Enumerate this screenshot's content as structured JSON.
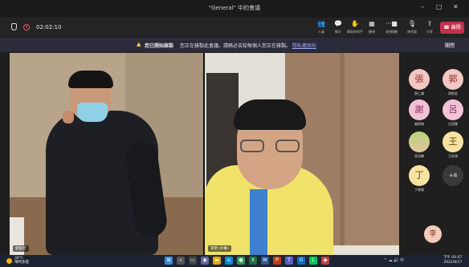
{
  "window": {
    "title": "\"General\" 中的會議",
    "min": "–",
    "max": "□",
    "close": "✕"
  },
  "toolbar": {
    "timer": "02:02:10",
    "buttons": [
      {
        "icon": "people-icon",
        "glyph": "👥",
        "label": "人員"
      },
      {
        "icon": "chat-icon",
        "glyph": "💬",
        "label": "聊天"
      },
      {
        "icon": "raise-hand-icon",
        "glyph": "✋",
        "label": "舉起你的手"
      },
      {
        "icon": "rooms-icon",
        "glyph": "▦",
        "label": "檢視"
      },
      {
        "icon": "more-icon",
        "glyph": "···",
        "label": "其他"
      },
      {
        "icon": "camera-icon",
        "glyph": "■",
        "label": "相機"
      },
      {
        "icon": "mic-off-icon",
        "glyph": "🎙",
        "label": "麥克風"
      },
      {
        "icon": "share-icon",
        "glyph": "⇪",
        "label": "分享"
      }
    ],
    "leave": "離開"
  },
  "banner": {
    "title": "您已開始錄製",
    "text": "您正在錄製此會議。請務必告知每個人您正在錄製。",
    "link": "隱私權原則",
    "dismiss": "關閉"
  },
  "stage": {
    "tile_a_name": "劉俊宏",
    "tile_b_name": "李明 (外賓)"
  },
  "participants": [
    {
      "initial": "張",
      "name": "張仁謙",
      "bg": "#f4c7c3",
      "fg": "#8c2a2a"
    },
    {
      "initial": "郭",
      "name": "郭柏宏",
      "bg": "#f4c7c3",
      "fg": "#8c2a2a"
    },
    {
      "initial": "謝",
      "name": "謝群翰",
      "bg": "#f3c2d8",
      "fg": "#8a2a58"
    },
    {
      "initial": "呂",
      "name": "呂昆霖",
      "bg": "#f3c2d8",
      "fg": "#8a2a58"
    },
    {
      "initial": "",
      "name": "吳岳峰",
      "bg": "#cfe0a8",
      "fg": "#333"
    },
    {
      "initial": "王",
      "name": "王佑瑞",
      "bg": "#f8e3a3",
      "fg": "#6b4a00"
    },
    {
      "initial": "丁",
      "name": "丁建威",
      "bg": "#f8e3a3",
      "fg": "#6b4a00"
    },
    {
      "initial": "+8",
      "name": "",
      "bg": "#3a3a3a",
      "fg": "#eeeeee"
    }
  ],
  "self_view": {
    "initial": "李"
  },
  "taskbar": {
    "temp": "30°C",
    "weather": "晴時多雲",
    "apps": [
      {
        "icon": "windows-icon",
        "glyph": "⊞",
        "color": "#3c8cd8"
      },
      {
        "icon": "search-icon",
        "glyph": "⌕",
        "color": "#555"
      },
      {
        "icon": "task-view-icon",
        "glyph": "▭",
        "color": "#444"
      },
      {
        "icon": "teams-chat-icon",
        "glyph": "◉",
        "color": "#6264a7"
      },
      {
        "icon": "file-explorer-icon",
        "glyph": "▬",
        "color": "#e0a800"
      },
      {
        "icon": "edge-icon",
        "glyph": "e",
        "color": "#0f8ad1"
      },
      {
        "icon": "chrome-icon",
        "glyph": "●",
        "color": "#2e9d4a"
      },
      {
        "icon": "excel-icon",
        "glyph": "X",
        "color": "#1d6f42"
      },
      {
        "icon": "word-icon",
        "glyph": "W",
        "color": "#2b579a"
      },
      {
        "icon": "powerpoint-icon",
        "glyph": "P",
        "color": "#c43e1c"
      },
      {
        "icon": "teams-icon",
        "glyph": "T",
        "color": "#5b5fc7"
      },
      {
        "icon": "outlook-icon",
        "glyph": "O",
        "color": "#0f6cbd"
      },
      {
        "icon": "line-icon",
        "glyph": "L",
        "color": "#06c755"
      },
      {
        "icon": "app-icon",
        "glyph": "◆",
        "color": "#b44"
      }
    ],
    "tray": "^ ☁ 🔊 中",
    "time": "下午 04:07",
    "date": "2022/8/17"
  }
}
